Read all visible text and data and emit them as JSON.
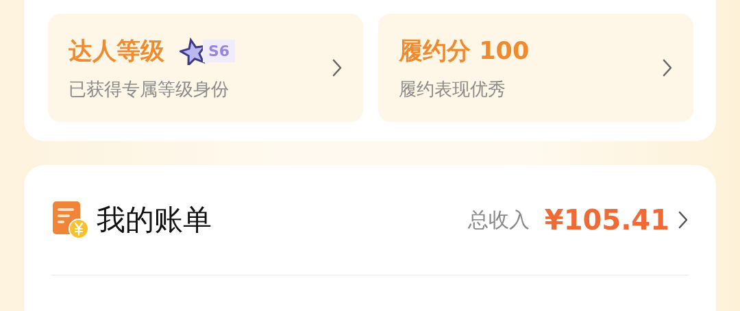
{
  "level_cards": [
    {
      "title": "达人等级",
      "badge": "S6",
      "subtitle": "已获得专属等级身份"
    },
    {
      "title": "履约分 100",
      "subtitle": "履约表现优秀"
    }
  ],
  "bill": {
    "title": "我的账单",
    "income_label": "总收入",
    "amount": "¥105.41"
  }
}
